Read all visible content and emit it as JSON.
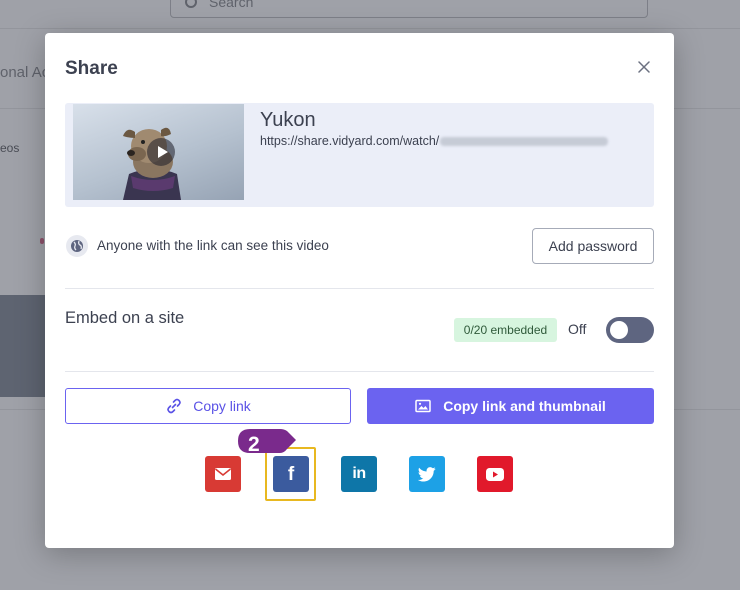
{
  "background": {
    "search_placeholder": "Search",
    "subnav_text": "onal Ac",
    "list_text": "eos"
  },
  "modal": {
    "title": "Share",
    "close_icon": "close-icon"
  },
  "video": {
    "title": "Yukon",
    "url": "https://share.vidyard.com/watch/",
    "url_id_obscured": true
  },
  "privacy": {
    "text": "Anyone with the link can see this video",
    "icon": "globe-icon",
    "add_password_label": "Add password"
  },
  "embed": {
    "label": "Embed on a site",
    "badge": "0/20 embedded",
    "toggle_label": "Off",
    "toggle_on": false
  },
  "actions": {
    "copy_link_label": "Copy link",
    "copy_link_icon": "link-icon",
    "copy_thumbnail_label": "Copy link and thumbnail",
    "copy_thumbnail_icon": "image-icon"
  },
  "social": {
    "email_icon": "email-icon",
    "facebook_icon": "facebook-icon",
    "facebook_glyph": "f",
    "linkedin_icon": "linkedin-icon",
    "linkedin_glyph": "in",
    "twitter_icon": "twitter-icon",
    "youtube_icon": "youtube-icon"
  },
  "annotation": {
    "step_number": "2"
  },
  "colors": {
    "accent": "#6b63f0",
    "email": "#d83a34",
    "facebook": "#3b5b9e",
    "linkedin": "#0e76a8",
    "twitter": "#1da1e6",
    "youtube": "#e1192b",
    "highlight": "#e8b820",
    "callout": "#7a2a8c",
    "embed_badge_bg": "#d7f5df",
    "toggle_off": "#5e6580"
  }
}
